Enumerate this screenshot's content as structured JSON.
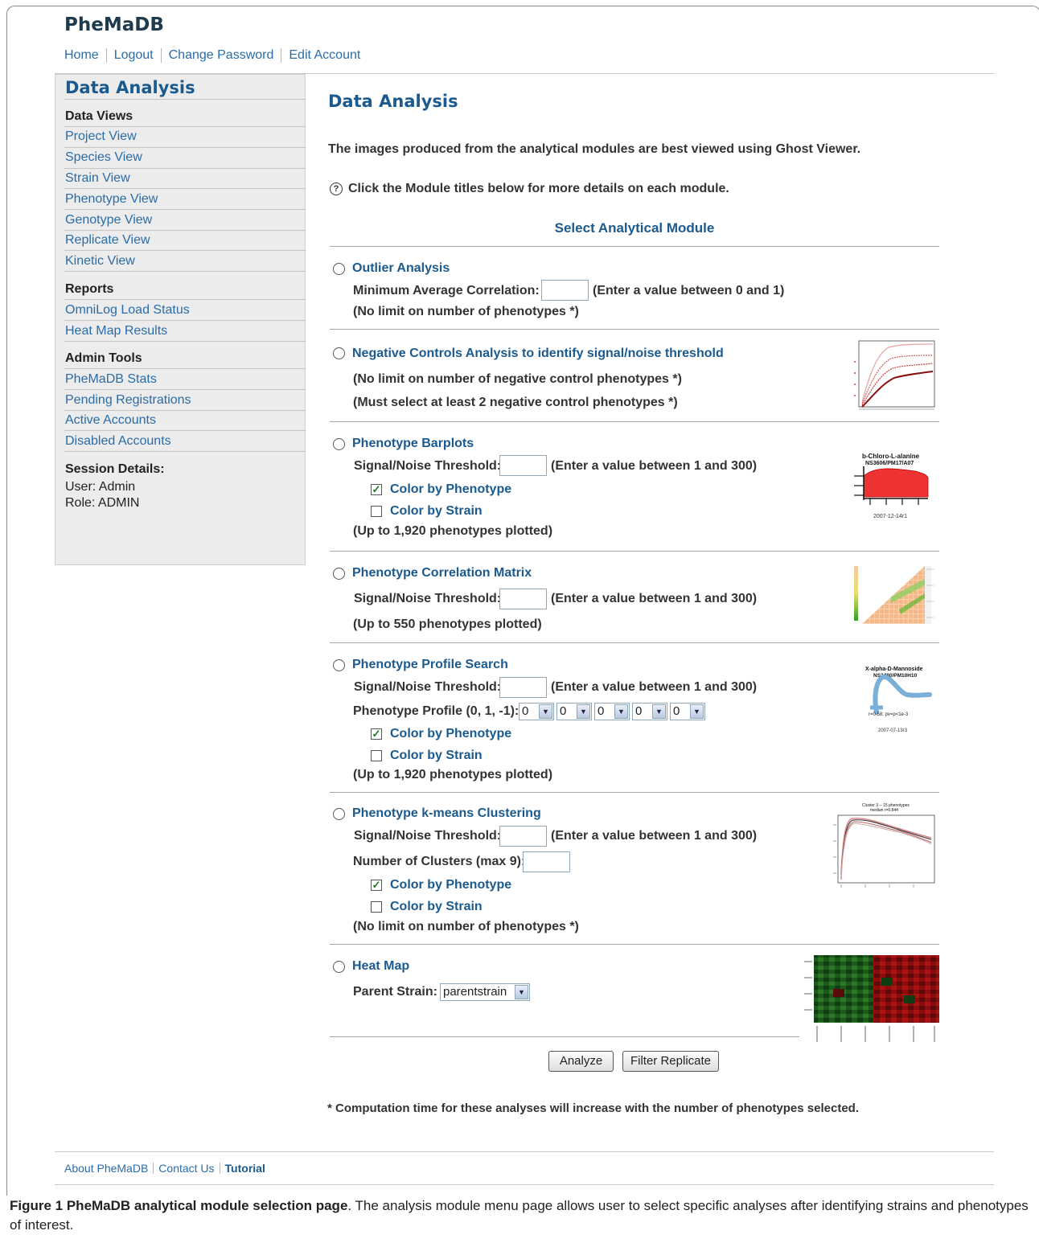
{
  "brand": "PheMaDB",
  "top_nav": [
    "Home",
    "Logout",
    "Change Password",
    "Edit Account"
  ],
  "sidebar": {
    "title": "Data Analysis",
    "views_heading": "Data Views",
    "views": [
      "Project View",
      "Species View",
      "Strain View",
      "Phenotype View",
      "Genotype View",
      "Replicate View",
      "Kinetic View"
    ],
    "reports_heading": "Reports",
    "reports": [
      "OmniLog Load Status",
      "Heat Map Results"
    ],
    "admin_heading": "Admin Tools",
    "admin": [
      "PheMaDB Stats",
      "Pending Registrations",
      "Active Accounts",
      "Disabled Accounts"
    ],
    "session_heading": "Session Details:",
    "user": "User: Admin",
    "role": "Role: ADMIN"
  },
  "main": {
    "title": "Data Analysis",
    "intro": "The images produced from the analytical modules are best viewed using Ghost Viewer.",
    "help_icon": "?",
    "help": "Click the Module titles below for more details on each module.",
    "select_title": "Select Analytical Module"
  },
  "modules": {
    "outlier": {
      "title": "Outlier Analysis",
      "field_label": "Minimum Average Correlation:",
      "hint": "(Enter a value between 0 and 1)",
      "note": "(No limit on number of phenotypes *)"
    },
    "negative": {
      "title": "Negative Controls Analysis to identify signal/noise threshold",
      "note1": "(No limit on number of negative control phenotypes *)",
      "note2": "(Must select at least 2 negative control phenotypes *)"
    },
    "barplots": {
      "title": "Phenotype Barplots",
      "field_label": "Signal/Noise Threshold:",
      "hint": "(Enter a value between 1 and 300)",
      "cb_phenotype": "Color by Phenotype",
      "cb_strain": "Color by Strain",
      "note": "(Up to 1,920 phenotypes plotted)",
      "thumb_title1": "b-Chloro-L-alanine",
      "thumb_title2": "NS3606/PM17/A07",
      "thumb_date": "2007-12-14r1"
    },
    "correlation": {
      "title": "Phenotype Correlation Matrix",
      "field_label": "Signal/Noise Threshold:",
      "hint": "(Enter a value between 1 and 300)",
      "note": "(Up to 550 phenotypes plotted)"
    },
    "profile": {
      "title": "Phenotype Profile Search",
      "field_label": "Signal/Noise Threshold:",
      "hint": "(Enter a value between 1 and 300)",
      "profile_label": "Phenotype Profile (0, 1, -1):",
      "profile_values": [
        "0",
        "0",
        "0",
        "0",
        "0"
      ],
      "cb_phenotype": "Color by Phenotype",
      "cb_strain": "Color by Strain",
      "note": "(Up to 1,920 phenotypes plotted)",
      "thumb_title1": "X-alpha-D-Mannoside",
      "thumb_title2": "NS2480/PM10H10",
      "thumb_stat": "r=0.58; pv=p<1e-3",
      "thumb_date": "2007-07-13r3"
    },
    "kmeans": {
      "title": "Phenotype k-means Clustering",
      "field_label": "Signal/Noise Threshold:",
      "hint": "(Enter a value between 1 and 300)",
      "clusters_label": "Number of Clusters (max 9):",
      "cb_phenotype": "Color by Phenotype",
      "cb_strain": "Color by Strain",
      "note": "(No limit on number of phenotypes *)",
      "thumb_title1": "Cluster 3 -- 15 phenotypes",
      "thumb_title2": "median r=0.844"
    },
    "heatmap": {
      "title": "Heat Map",
      "parent_label": "Parent Strain:",
      "parent_value": "parentstrain"
    }
  },
  "buttons": {
    "analyze": "Analyze",
    "filter": "Filter Replicate"
  },
  "footnote": "* Computation time for these analyses will increase with the number of phenotypes selected.",
  "footer": {
    "about": "About PheMaDB",
    "contact": "Contact Us",
    "tutorial": "Tutorial"
  },
  "caption": {
    "label": "Figure 1 PheMaDB analytical module selection page",
    "text": ". The analysis module menu page allows user to select specific analyses after identifying strains and phenotypes of interest."
  },
  "colors": {
    "link": "#2a6ca8",
    "heading": "#1b5a8e",
    "sidebar_bg": "#ececec"
  }
}
